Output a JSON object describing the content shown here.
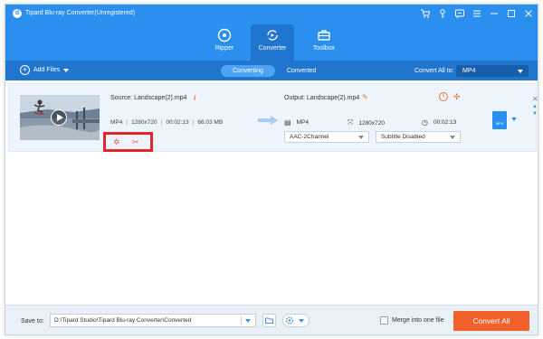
{
  "window": {
    "title": "Tipard Blu-ray Converter(Unregistered)"
  },
  "nav": {
    "tabs": [
      {
        "label": "Ripper",
        "icon": "disc-icon"
      },
      {
        "label": "Converter",
        "icon": "converter-icon",
        "active": true
      },
      {
        "label": "Toolbox",
        "icon": "toolbox-icon"
      }
    ]
  },
  "toolbar": {
    "add_files_label": "Add Files",
    "segments": [
      "Converting",
      "Converted"
    ],
    "active_segment": "Converting",
    "convert_all_to_label": "Convert All to:",
    "convert_all_to_value": "MP4"
  },
  "file": {
    "source": "Source: Landscape(2).mp4",
    "format": "MP4",
    "resolution": "1280x720",
    "duration": "00:02:13",
    "size": "66.03 MB",
    "output": "Output: Landscape(2).mp4",
    "output_format": "MP4",
    "output_resolution": "1280x720",
    "output_duration": "00:02:13",
    "audio_track": "AAC-2Channel",
    "subtitle": "Subtitle Disabled",
    "format_icon_label": "MP4"
  },
  "bottom": {
    "save_to_label": "Save to:",
    "save_path": "D:\\Tipard Studio\\Tipard Blu-ray Converter\\Converted",
    "merge_label": "Merge into one file",
    "merge_checked": false,
    "convert_all_label": "Convert All"
  },
  "colors": {
    "header": "#2b8ff0",
    "toolbar": "#2075cf",
    "accent_orange": "#f0602b",
    "highlight_box": "#e0252b"
  }
}
